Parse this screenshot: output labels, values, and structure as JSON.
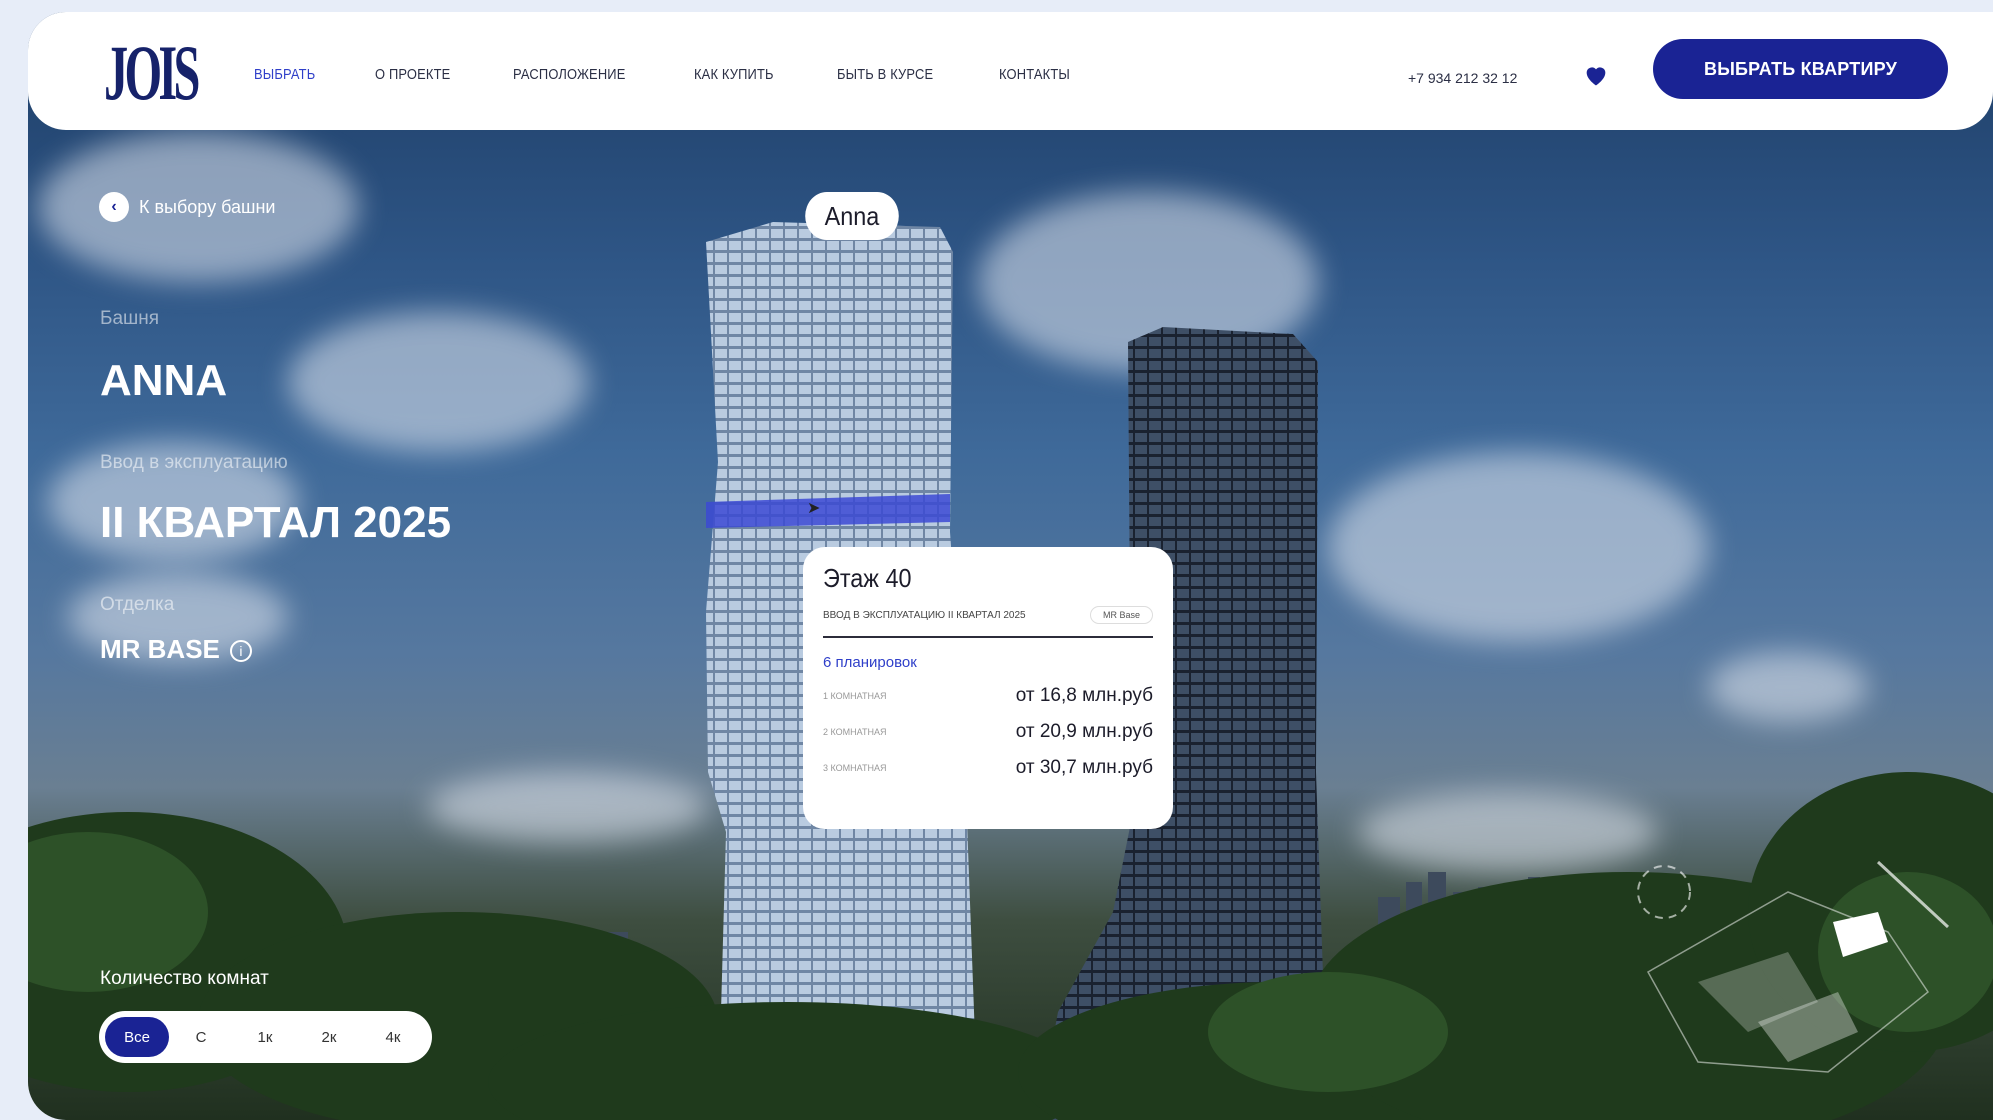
{
  "header": {
    "logo": "JOIS",
    "nav": [
      "ВЫБРАТЬ",
      "О ПРОЕКТЕ",
      "РАСПОЛОЖЕНИЕ",
      "КАК КУПИТЬ",
      "БЫТЬ В КУРСЕ",
      "КОНТАКТЫ"
    ],
    "phone": "+7 934 212 32 12",
    "cta": "ВЫБРАТЬ КВАРТИРУ",
    "accent": "#1a2394"
  },
  "sidebar": {
    "back": "К выбору башни",
    "tower_label": "Башня",
    "tower_value": "ANNA",
    "delivery_label": "Ввод в эксплуатацию",
    "delivery_value": "II КВАРТАЛ 2025",
    "finish_label": "Отделка",
    "finish_value": "MR BASE",
    "rooms_label": "Количество комнат",
    "rooms": [
      "Все",
      "С",
      "1к",
      "2к",
      "4к"
    ]
  },
  "tower_tag": "Anna",
  "popup": {
    "title": "Этаж 40",
    "meta": "ВВОД В ЭКСПЛУАТАЦИЮ II КВАРТАЛ 2025",
    "badge": "MR Base",
    "count": "6 планировок",
    "rows": [
      {
        "label": "1 КОМНАТНАЯ",
        "price": "от 16,8 млн.руб"
      },
      {
        "label": "2 КОМНАТНАЯ",
        "price": "от 20,9 млн.руб"
      },
      {
        "label": "3 КОМНАТНАЯ",
        "price": "от 30,7 млн.руб"
      }
    ]
  }
}
